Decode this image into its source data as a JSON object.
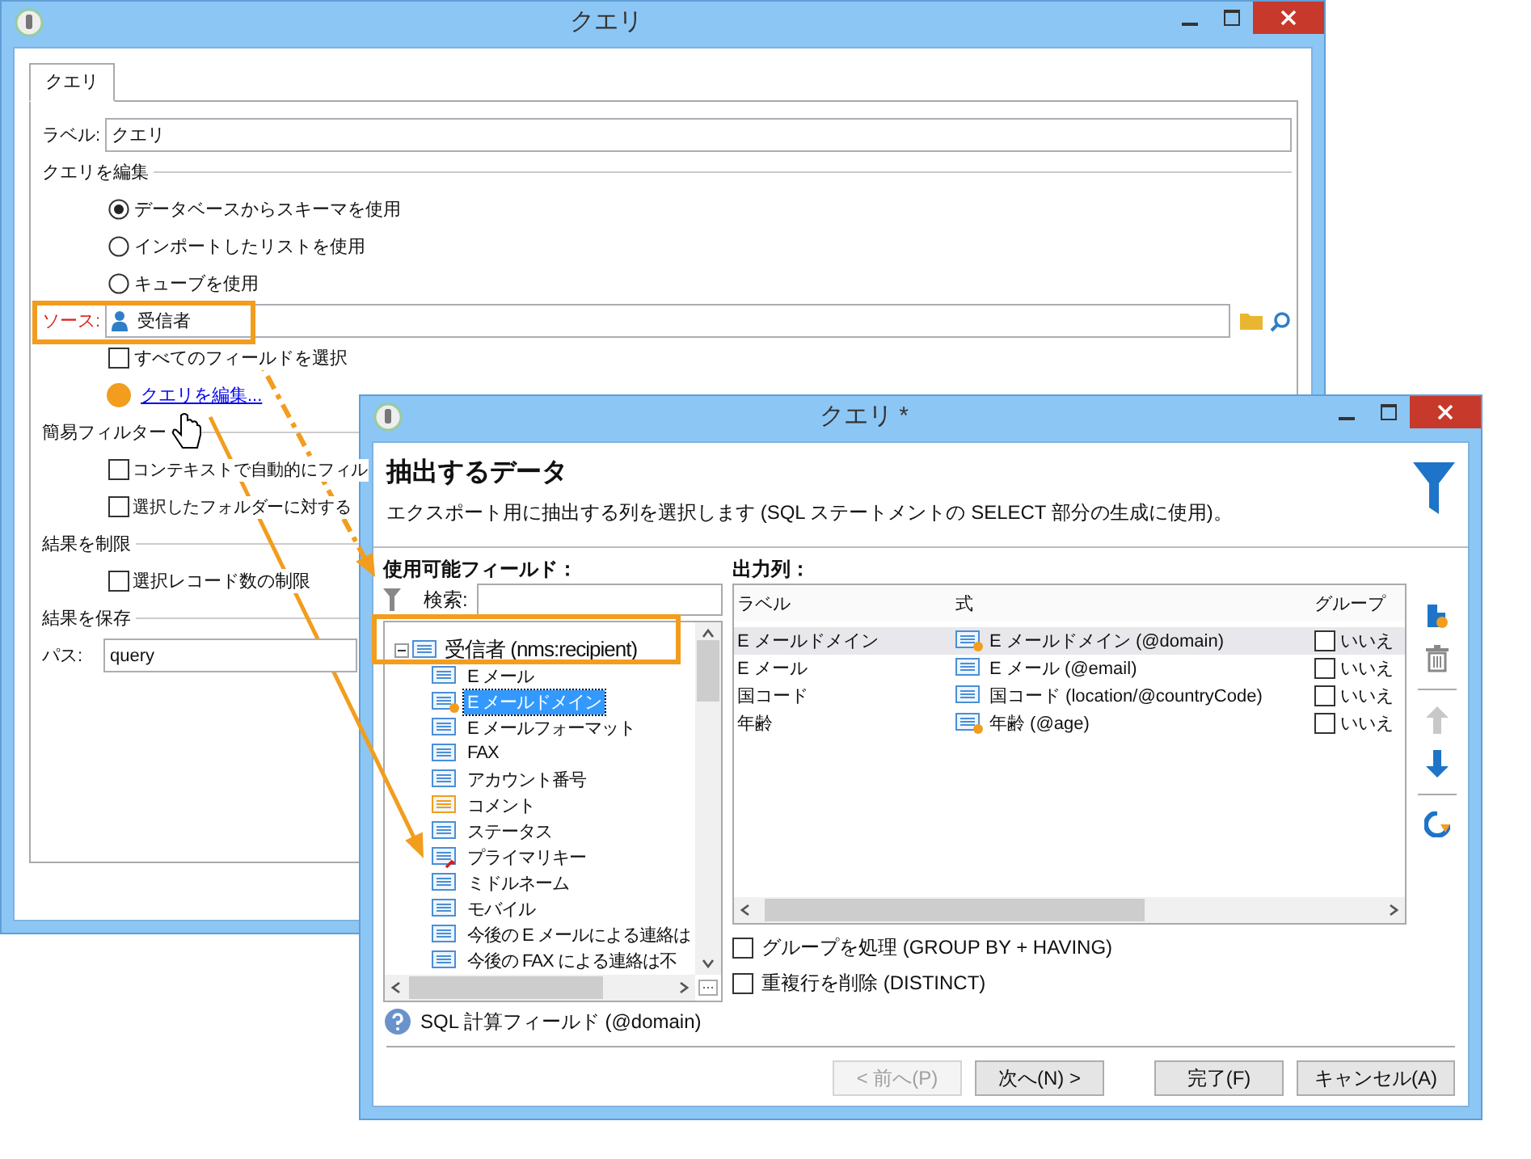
{
  "back_window": {
    "title": "クエリ",
    "tabs": [
      {
        "label": "クエリ",
        "selected": true
      }
    ],
    "label_field": {
      "label": "ラベル:",
      "value": "クエリ"
    },
    "edit_group": {
      "title": "クエリを編集",
      "options": [
        {
          "label": "データベースからスキーマを使用",
          "selected": true
        },
        {
          "label": "インポートしたリストを使用",
          "selected": false
        },
        {
          "label": "キューブを使用",
          "selected": false
        }
      ]
    },
    "source": {
      "label": "ソース:",
      "value": "受信者"
    },
    "select_all": {
      "label": "すべてのフィールドを選択",
      "checked": false
    },
    "edit_link": "クエリを編集...",
    "filter_group": {
      "title": "簡易フィルター",
      "options": [
        {
          "label": "コンテキストで自動的にフィル",
          "checked": false
        },
        {
          "label": "選択したフォルダーに対する",
          "checked": false
        }
      ]
    },
    "limit_group": {
      "title": "結果を制限",
      "options": [
        {
          "label": "選択レコード数の制限",
          "checked": false
        }
      ]
    },
    "save_group": {
      "title": "結果を保存",
      "path_label": "パス:",
      "path_value": "query"
    }
  },
  "front_window": {
    "title": "クエリ *",
    "heading": "抽出するデータ",
    "description": "エクスポート用に抽出する列を選択します (SQL ステートメントの SELECT 部分の生成に使用)。",
    "fields_label": "使用可能フィールド：",
    "search_label": "検索:",
    "tree": [
      {
        "label": "受信者 (nms:recipient)",
        "expanded": true,
        "children": [
          {
            "label": "E メール",
            "kind": "field",
            "selected": false
          },
          {
            "label": "E メールドメイン",
            "kind": "computed",
            "selected": true
          },
          {
            "label": "E メールフォーマット",
            "kind": "field",
            "selected": false
          },
          {
            "label": "FAX",
            "kind": "field",
            "selected": false
          },
          {
            "label": "アカウント番号",
            "kind": "field",
            "selected": false
          },
          {
            "label": "コメント",
            "kind": "comment",
            "selected": false
          },
          {
            "label": "ステータス",
            "kind": "field",
            "selected": false
          },
          {
            "label": "プライマリキー",
            "kind": "key",
            "selected": false
          },
          {
            "label": "ミドルネーム",
            "kind": "field",
            "selected": false
          },
          {
            "label": "モバイル",
            "kind": "field",
            "selected": false
          },
          {
            "label": "今後の E メールによる連絡は",
            "kind": "field",
            "selected": false
          },
          {
            "label": "今後の FAX による連絡は不",
            "kind": "field",
            "selected": false
          }
        ]
      }
    ],
    "output_label": "出力列：",
    "columns": [
      "ラベル",
      "式",
      "グループ"
    ],
    "rows": [
      {
        "label": "E メールドメイン",
        "expression": "E メールドメイン (@domain)",
        "kind": "computed",
        "group": "いいえ",
        "group_checked": false,
        "selected": true
      },
      {
        "label": "E メール",
        "expression": "E メール (@email)",
        "kind": "field",
        "group": "いいえ",
        "group_checked": false,
        "selected": false
      },
      {
        "label": "国コード",
        "expression": "国コード (location/@countryCode)",
        "kind": "field",
        "group": "いいえ",
        "group_checked": false,
        "selected": false
      },
      {
        "label": "年齢",
        "expression": "年齢 (@age)",
        "kind": "computed",
        "group": "いいえ",
        "group_checked": false,
        "selected": false
      }
    ],
    "toolbar": [
      {
        "kind": "add",
        "disabled": false
      },
      {
        "kind": "delete",
        "disabled": true
      },
      {
        "kind": "up",
        "disabled": true
      },
      {
        "kind": "down",
        "disabled": false
      },
      {
        "kind": "distribution",
        "disabled": false
      }
    ],
    "options": [
      {
        "label": "グループを処理 (GROUP BY + HAVING)",
        "checked": false
      },
      {
        "label": "重複行を削除 (DISTINCT)",
        "checked": false
      }
    ],
    "hint": "SQL 計算フィールド (@domain)",
    "buttons": [
      {
        "label": "< 前へ(P)",
        "disabled": true
      },
      {
        "label": "次へ(N) >",
        "disabled": false
      },
      {
        "label": "完了(F)",
        "disabled": false
      },
      {
        "label": "キャンセル(A)",
        "disabled": false
      }
    ]
  }
}
